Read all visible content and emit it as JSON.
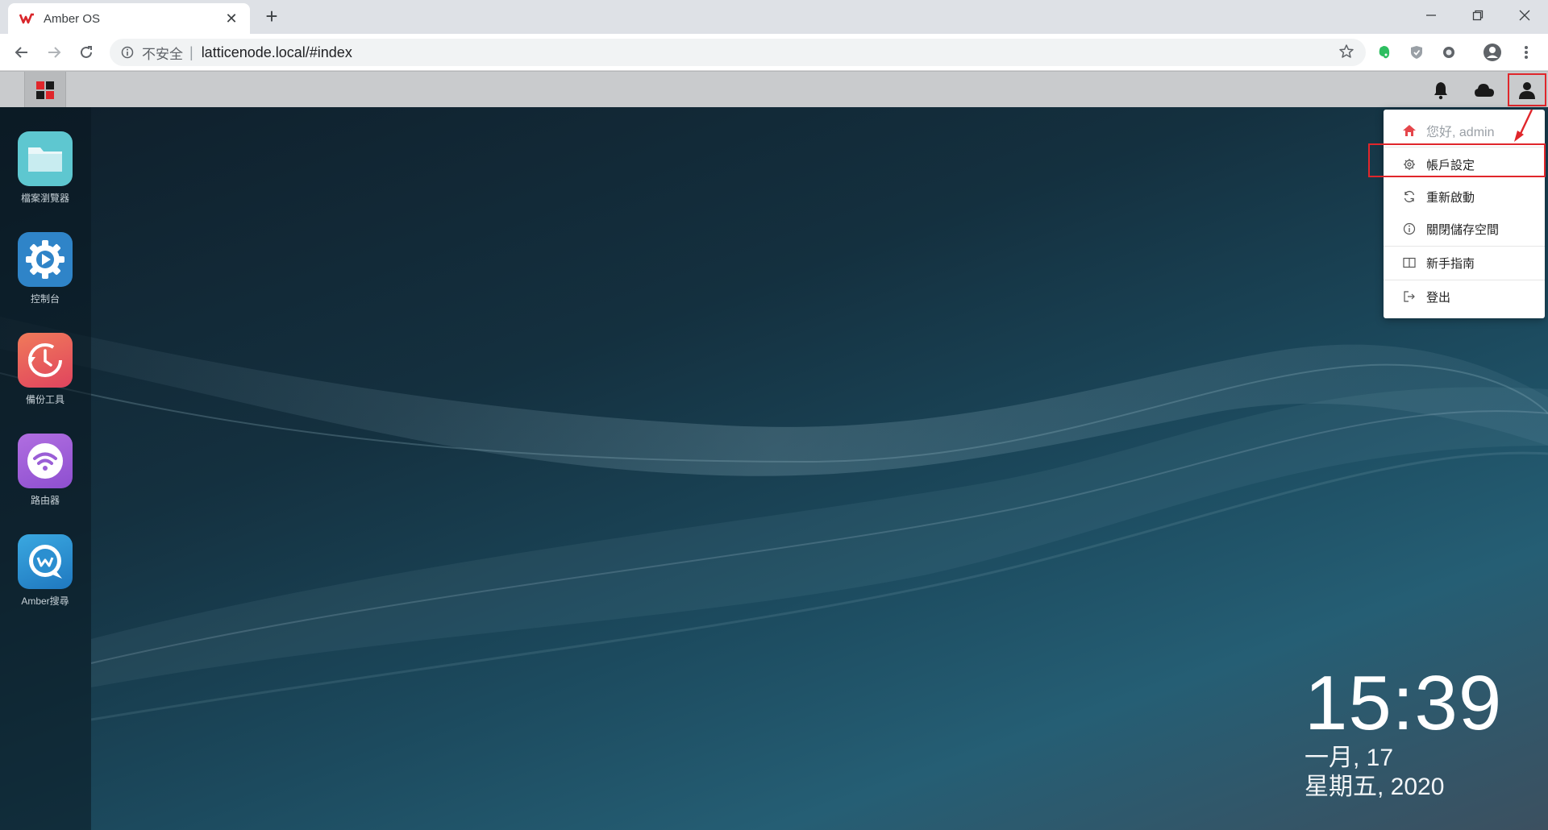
{
  "browser": {
    "tab_title": "Amber OS",
    "security_label": "不安全",
    "url": "latticenode.local/#index"
  },
  "user_menu": {
    "greeting": "您好, admin",
    "items": [
      {
        "label": "帳戶設定",
        "icon": "gear-icon"
      },
      {
        "label": "重新啟動",
        "icon": "refresh-icon"
      },
      {
        "label": "關閉儲存空間",
        "icon": "info-icon"
      },
      {
        "label": "新手指南",
        "icon": "book-icon"
      },
      {
        "label": "登出",
        "icon": "logout-icon"
      }
    ]
  },
  "dock": {
    "apps": [
      {
        "label": "檔案瀏覽器",
        "icon": "folder-icon",
        "color": "#5ec7d0"
      },
      {
        "label": "控制台",
        "icon": "settings-gear-icon",
        "color": "#2f84c8"
      },
      {
        "label": "備份工具",
        "icon": "backup-clock-icon",
        "color": "#e8505b"
      },
      {
        "label": "路由器",
        "icon": "wifi-icon",
        "color": "#9a5ed6"
      },
      {
        "label": "Amber搜尋",
        "icon": "search-chat-icon",
        "color": "#2b8fd0"
      }
    ]
  },
  "clock": {
    "time": "15:39",
    "date_line1": "一月, 17",
    "date_line2": "星期五, 2020"
  },
  "colors": {
    "accent_red": "#e0262b",
    "taskbar": "#c9cbcd"
  }
}
